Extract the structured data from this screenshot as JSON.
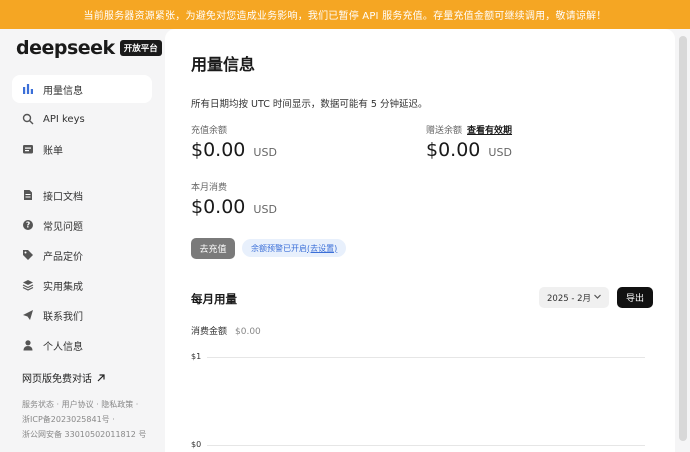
{
  "banner": {
    "text": "当前服务器资源紧张，为避免对您造成业务影响，我们已暂停 API 服务充值。存量充值金额可继续调用，敬请谅解！"
  },
  "logo": {
    "name": "deepseek",
    "badge": "开放平台"
  },
  "sidebar": {
    "items": [
      {
        "label": "用量信息",
        "icon": "bar-chart-icon"
      },
      {
        "label": "API keys",
        "icon": "search-key-icon"
      },
      {
        "label": "账单",
        "icon": "bill-icon"
      },
      {
        "label": "接口文档",
        "icon": "document-icon"
      },
      {
        "label": "常见问题",
        "icon": "question-icon"
      },
      {
        "label": "产品定价",
        "icon": "price-tag-icon"
      },
      {
        "label": "实用集成",
        "icon": "layers-icon"
      },
      {
        "label": "联系我们",
        "icon": "send-icon"
      },
      {
        "label": "个人信息",
        "icon": "person-icon"
      }
    ],
    "webchat": "网页版免费对话",
    "footer": {
      "line1": "服务状态 · 用户协议 · 隐私政策 ·",
      "line2": "浙ICP备2023025841号 ·",
      "line3": "浙公网安备 33010502011812 号"
    }
  },
  "main": {
    "title": "用量信息",
    "note": "所有日期均按 UTC 时间显示，数据可能有 5 分钟延迟。",
    "balance": {
      "label": "充值余额",
      "value": "$0.00",
      "currency": "USD"
    },
    "gift": {
      "label": "赠送余额",
      "link": "查看有效期",
      "value": "$0.00",
      "currency": "USD"
    },
    "monthly": {
      "label": "本月消费",
      "value": "$0.00",
      "currency": "USD"
    },
    "topup_button": "去充值",
    "alert": {
      "text": "余额预警已开启",
      "link": "(去设置)"
    },
    "usage": {
      "title": "每月用量",
      "month": "2025 - 2月",
      "export": "导出",
      "cost_label": "消费金额",
      "cost_value": "$0.00",
      "axis_top": "$1",
      "axis_bottom": "$0"
    }
  },
  "colors": {
    "banner": "#f5a623",
    "accent": "#3b6fd8",
    "active_bg": "#ffffff"
  }
}
